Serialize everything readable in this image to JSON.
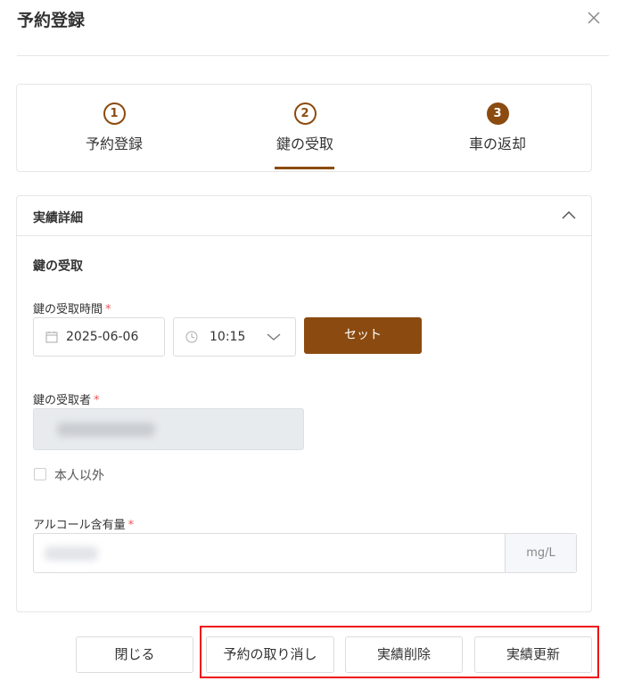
{
  "dialog": {
    "title": "予約登録"
  },
  "steps": [
    {
      "num": "1",
      "label": "予約登録",
      "state": "done"
    },
    {
      "num": "2",
      "label": "鍵の受取",
      "state": "active"
    },
    {
      "num": "3",
      "label": "車の返却",
      "state": "pending"
    }
  ],
  "panel": {
    "title": "実績詳細",
    "section_title": "鍵の受取",
    "pickup_time": {
      "label": "鍵の受取時間",
      "required_mark": "*",
      "date": "2025-06-06",
      "time": "10:15",
      "set_button": "セット"
    },
    "receiver": {
      "label": "鍵の受取者",
      "required_mark": "*"
    },
    "not_self": {
      "label": "本人以外",
      "checked": false
    },
    "alcohol": {
      "label": "アルコール含有量",
      "required_mark": "*",
      "unit": "mg/L"
    }
  },
  "footer": {
    "close": "閉じる",
    "cancel_reservation": "予約の取り消し",
    "delete_record": "実績削除",
    "update_record": "実績更新"
  },
  "colors": {
    "accent": "#8b4b10",
    "highlight": "#e11111"
  },
  "icons": {
    "close": "close-icon",
    "collapse": "chevron-up-icon",
    "date": "calendar-icon",
    "time": "clock-icon",
    "dropdown": "chevron-down-icon"
  }
}
